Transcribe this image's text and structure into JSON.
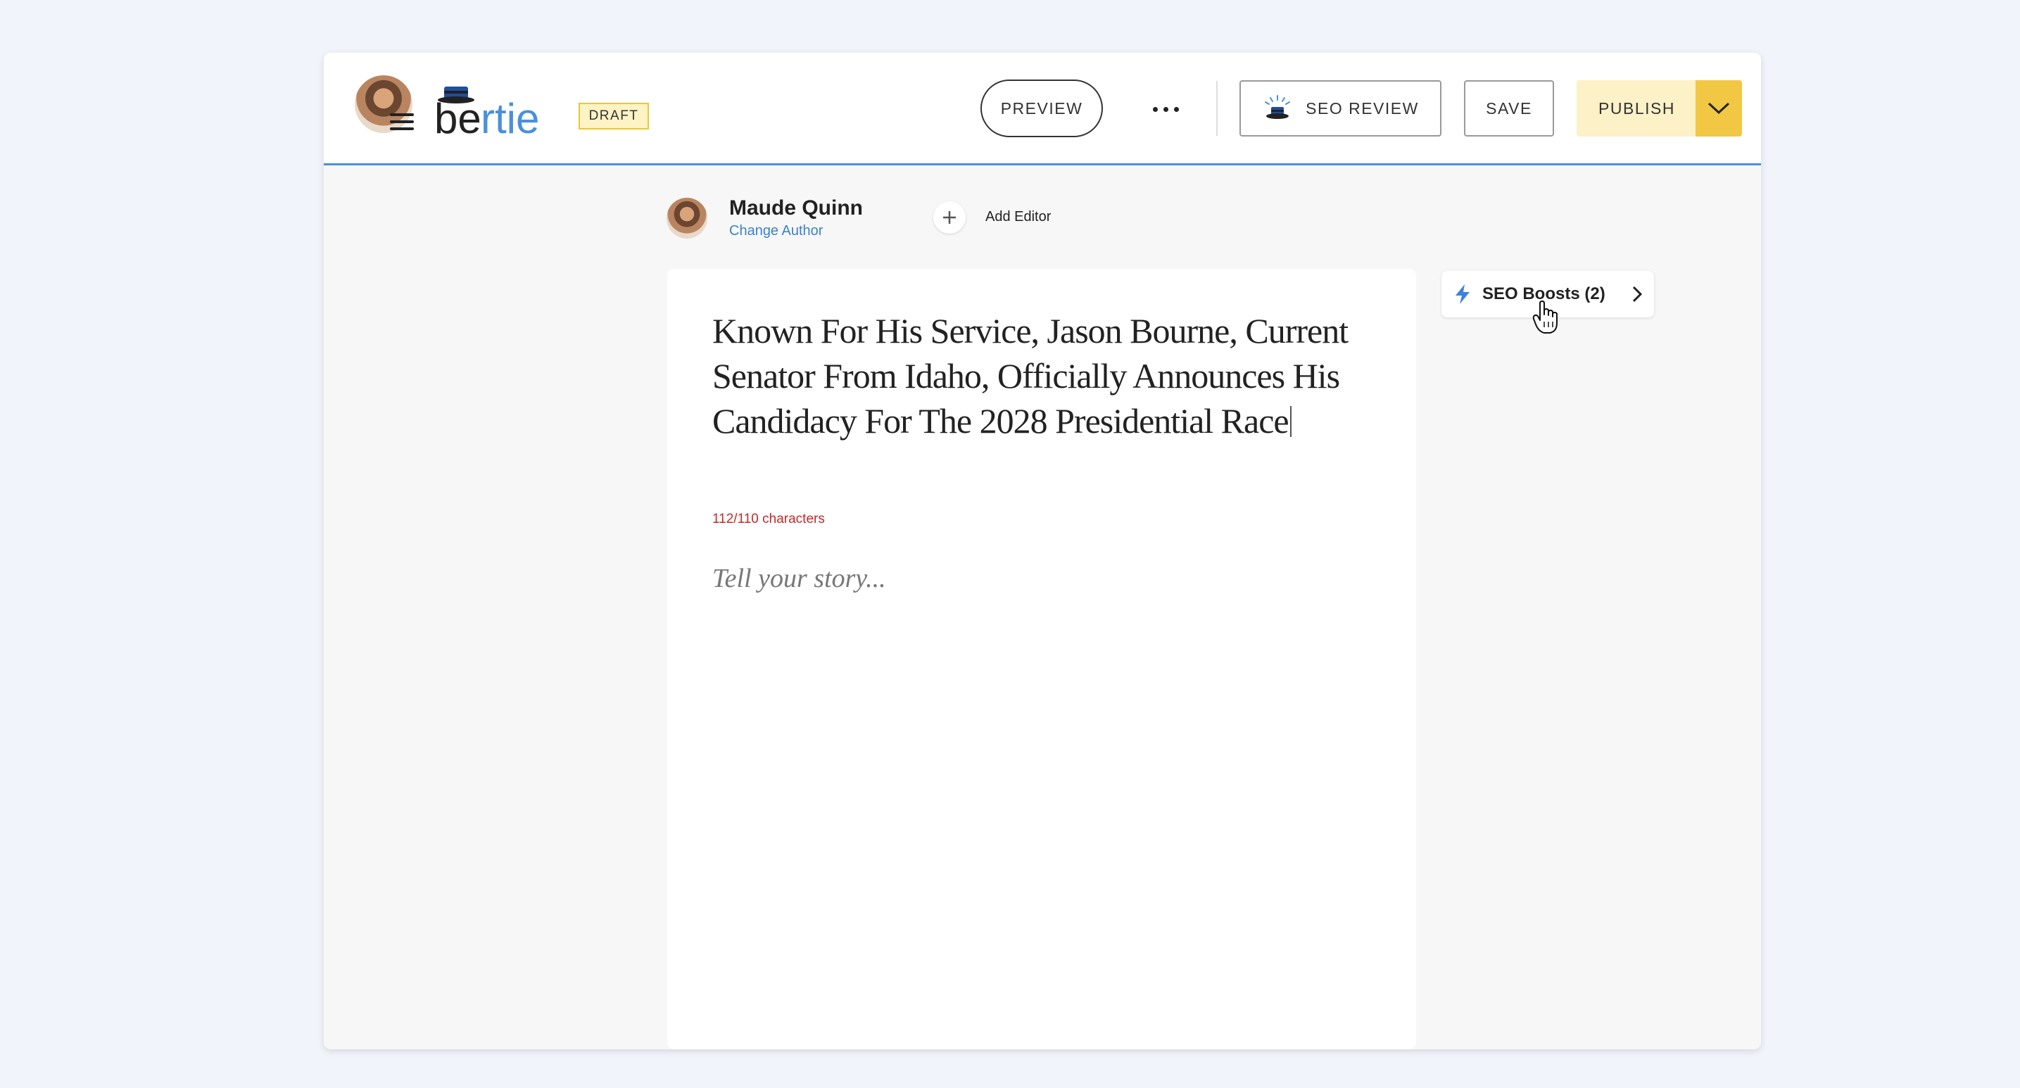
{
  "header": {
    "logo_text": "bertie",
    "draft_badge": "DRAFT",
    "preview_label": "PREVIEW",
    "seo_review_label": "SEO REVIEW",
    "save_label": "SAVE",
    "publish_label": "PUBLISH"
  },
  "author": {
    "name": "Maude Quinn",
    "change_author_label": "Change Author",
    "add_editor_label": "Add Editor"
  },
  "editor": {
    "headline": "Known For His Service, Jason Bourne, Current Senator From Idaho, Officially Announces His Candidacy For The 2028 Presidential Race",
    "char_count": "112/110 characters",
    "body_placeholder": "Tell your story..."
  },
  "seo_boosts": {
    "label": "SEO Boosts (2)"
  },
  "icons": [
    "menu-icon",
    "more-icon",
    "seo-hat-icon",
    "chevron-down-icon",
    "plus-icon",
    "bolt-icon",
    "chevron-right-icon",
    "hand-cursor-icon"
  ],
  "colors": {
    "accent_blue": "#4a90d9",
    "publish_yellow": "#f2c744",
    "publish_light": "#fdf1c7",
    "error_red": "#c62828",
    "link_blue": "#3b82c8"
  }
}
